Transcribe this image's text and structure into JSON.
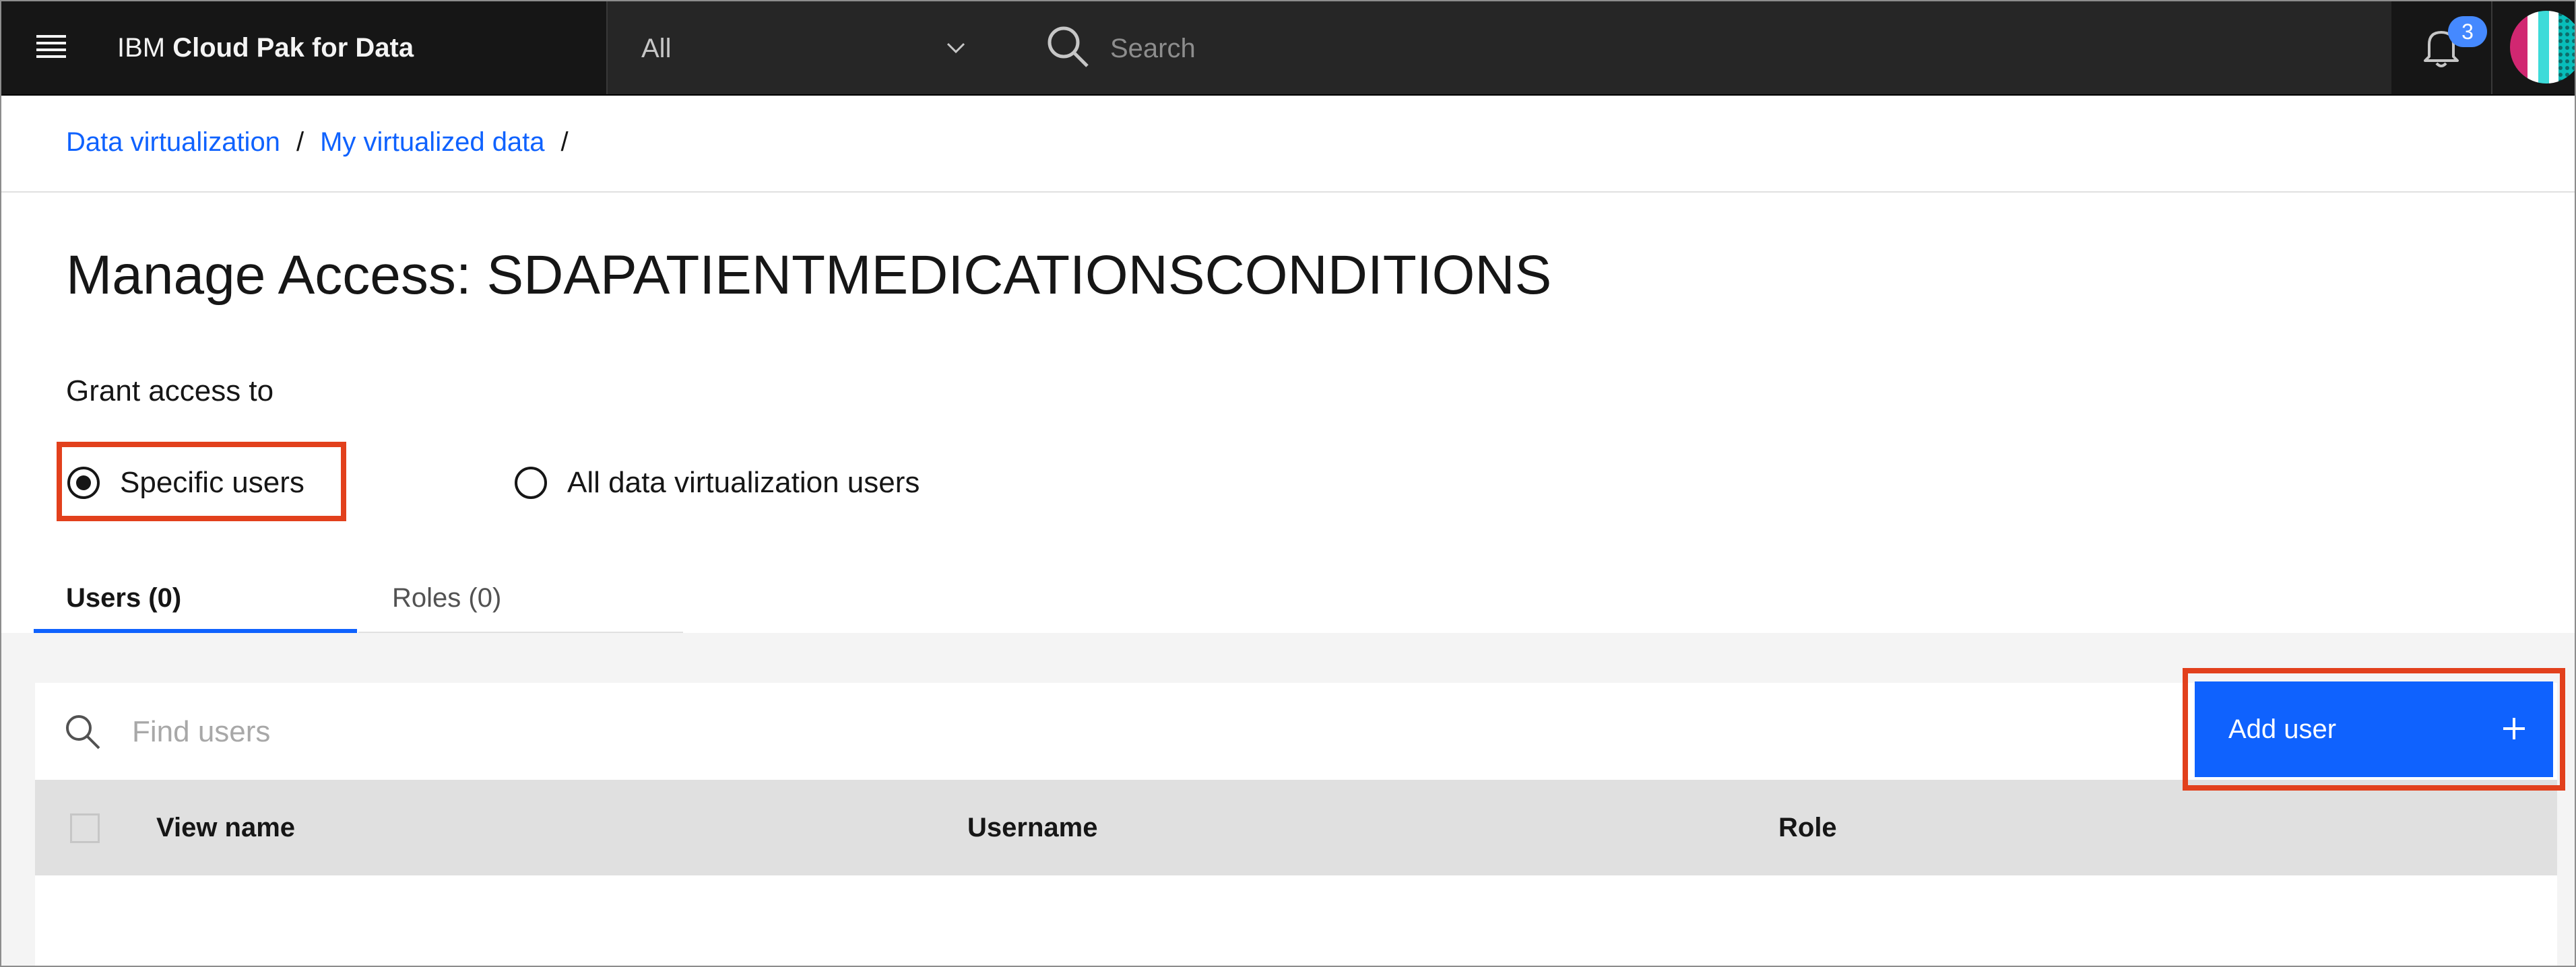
{
  "header": {
    "brand_prefix": "IBM",
    "brand_name": "Cloud Pak for Data",
    "scope_value": "All",
    "search_placeholder": "Search",
    "notification_count": "3",
    "icons": [
      "menu-icon",
      "chevron-down-icon",
      "search-icon",
      "notification-bell-icon",
      "avatar"
    ]
  },
  "breadcrumb": {
    "items": [
      "Data virtualization",
      "My virtualized data"
    ],
    "separator": "/"
  },
  "page": {
    "title": "Manage Access: SDAPATIENTMEDICATIONSCONDITIONS",
    "grant_label": "Grant access to",
    "radio_options": [
      {
        "label": "Specific users",
        "selected": true
      },
      {
        "label": "All data virtualization users",
        "selected": false
      }
    ]
  },
  "tabs": [
    {
      "label": "Users (0)",
      "active": true
    },
    {
      "label": "Roles (0)",
      "active": false
    }
  ],
  "table": {
    "search_placeholder": "Find users",
    "add_button_label": "Add user",
    "columns": [
      "View name",
      "Username",
      "Role"
    ],
    "rows": []
  },
  "colors": {
    "header_bg": "#161616",
    "accent_blue": "#0f62fe",
    "highlight_red": "#e2401c",
    "badge_blue": "#4589ff"
  }
}
